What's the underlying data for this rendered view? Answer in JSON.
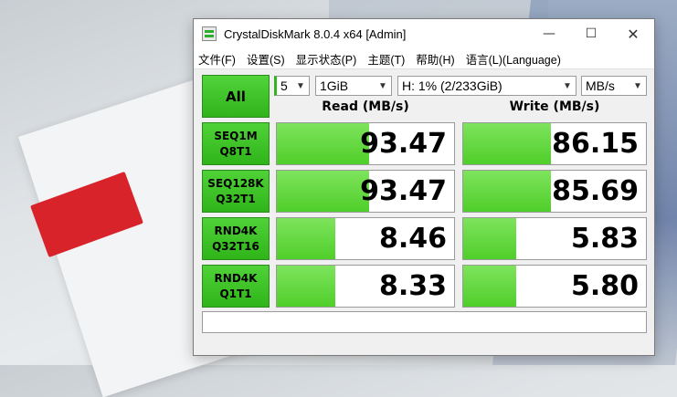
{
  "window": {
    "title": "CrystalDiskMark 8.0.4 x64 [Admin]",
    "minimize": "—",
    "maximize": "☐",
    "close": "✕"
  },
  "menu": [
    "文件(F)",
    "设置(S)",
    "显示状态(P)",
    "主题(T)",
    "帮助(H)",
    "语言(L)(Language)"
  ],
  "controls": {
    "all_label": "All",
    "count": "5",
    "size": "1GiB",
    "drive": "H: 1% (2/233GiB)",
    "unit": "MB/s"
  },
  "headers": {
    "read": "Read (MB/s)",
    "write": "Write (MB/s)"
  },
  "tests": [
    {
      "line1": "SEQ1M",
      "line2": "Q8T1",
      "read": "93.47",
      "write": "86.15",
      "read_fill": 0.52,
      "write_fill": 0.48
    },
    {
      "line1": "SEQ128K",
      "line2": "Q32T1",
      "read": "93.47",
      "write": "85.69",
      "read_fill": 0.52,
      "write_fill": 0.48
    },
    {
      "line1": "RND4K",
      "line2": "Q32T16",
      "read": "8.46",
      "write": "5.83",
      "read_fill": 0.33,
      "write_fill": 0.29
    },
    {
      "line1": "RND4K",
      "line2": "Q1T1",
      "read": "8.33",
      "write": "5.80",
      "read_fill": 0.33,
      "write_fill": 0.29
    }
  ],
  "status": "",
  "colors": {
    "accent_green": "#4fcf2a",
    "button_green": "#30b31b"
  }
}
